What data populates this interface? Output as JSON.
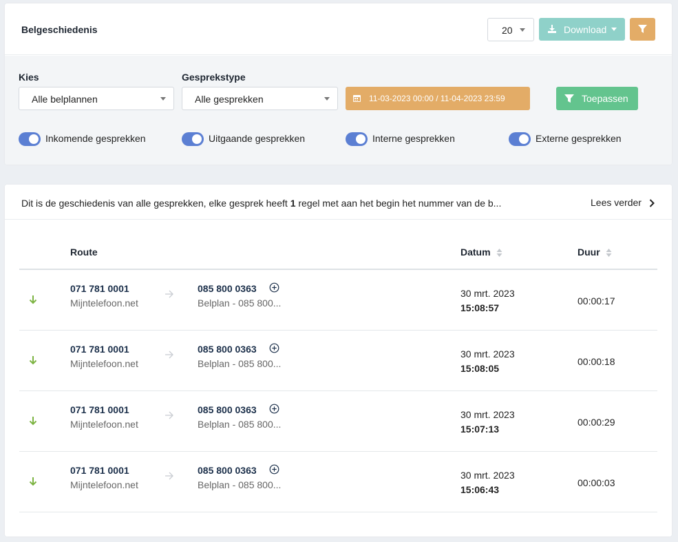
{
  "header": {
    "title": "Belgeschiedenis",
    "page_size": "20",
    "download_label": "Download"
  },
  "filters": {
    "kies_label": "Kies",
    "kies_value": "Alle belplannen",
    "type_label": "Gesprekstype",
    "type_value": "Alle gesprekken",
    "date_range": "11-03-2023 00:00 / 11-04-2023 23:59",
    "apply_label": "Toepassen",
    "toggles": [
      {
        "label": "Inkomende gesprekken",
        "on": true
      },
      {
        "label": "Uitgaande gesprekken",
        "on": true
      },
      {
        "label": "Interne gesprekken",
        "on": true
      },
      {
        "label": "Externe gesprekken",
        "on": true
      }
    ]
  },
  "info": {
    "text_before": "Dit is de geschiedenis van alle gesprekken, elke gesprek heeft ",
    "text_bold": "1",
    "text_after": " regel met aan het begin het nummer van de b...",
    "read_more": "Lees verder"
  },
  "table": {
    "columns": {
      "route": "Route",
      "datum": "Datum",
      "duur": "Duur"
    },
    "rows": [
      {
        "src_num": "071 781 0001",
        "src_name": "Mijntelefoon.net",
        "dst_num": "085 800 0363",
        "dst_name": "Belplan - 085 800...",
        "date": "30 mrt. 2023",
        "time": "15:08:57",
        "dur": "00:00:17"
      },
      {
        "src_num": "071 781 0001",
        "src_name": "Mijntelefoon.net",
        "dst_num": "085 800 0363",
        "dst_name": "Belplan - 085 800...",
        "date": "30 mrt. 2023",
        "time": "15:08:05",
        "dur": "00:00:18"
      },
      {
        "src_num": "071 781 0001",
        "src_name": "Mijntelefoon.net",
        "dst_num": "085 800 0363",
        "dst_name": "Belplan - 085 800...",
        "date": "30 mrt. 2023",
        "time": "15:07:13",
        "dur": "00:00:29"
      },
      {
        "src_num": "071 781 0001",
        "src_name": "Mijntelefoon.net",
        "dst_num": "085 800 0363",
        "dst_name": "Belplan - 085 800...",
        "date": "30 mrt. 2023",
        "time": "15:06:43",
        "dur": "00:00:03"
      }
    ]
  },
  "colors": {
    "toggle_on": "#5b7fd3",
    "download_btn": "#8fd1c9",
    "filter_btn": "#e3ac67",
    "apply_btn": "#63c48e",
    "incoming_arrow": "#7cb342"
  }
}
